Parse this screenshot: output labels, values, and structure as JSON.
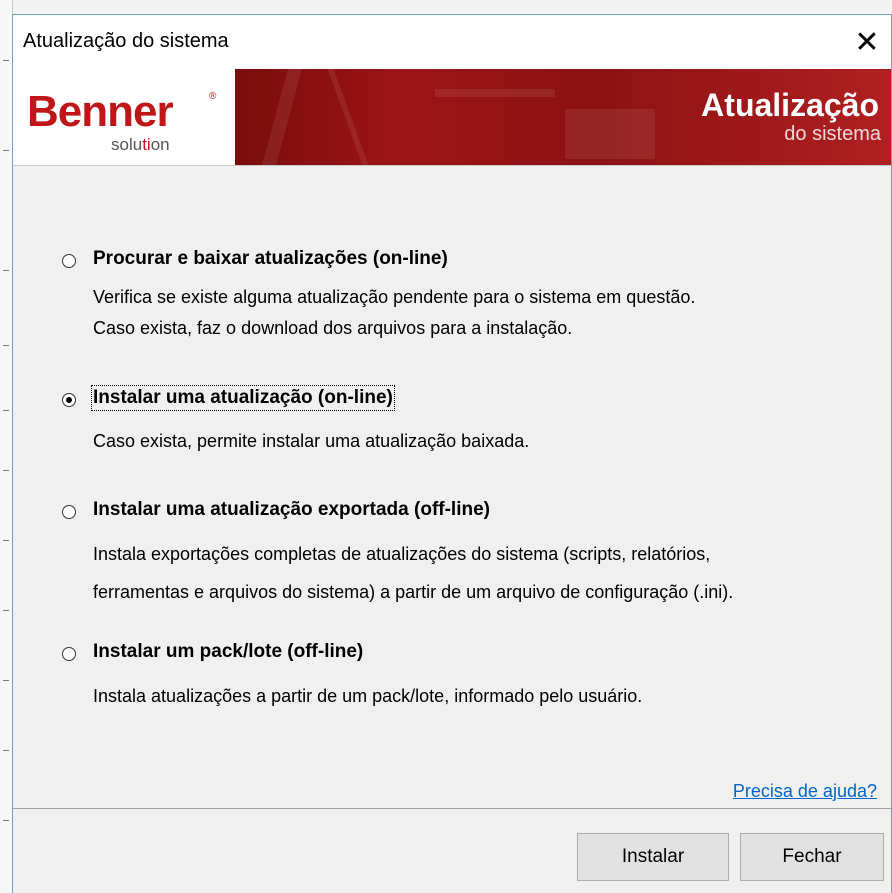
{
  "window": {
    "title": "Atualização do sistema",
    "close_glyph": "✕"
  },
  "banner": {
    "logo_main": "Benner",
    "logo_registered": "®",
    "logo_sub_part1": "solu",
    "logo_sub_accent": "ti",
    "logo_sub_part2": "on",
    "title": "Atualização",
    "subtitle": "do sistema",
    "colors": {
      "brand_red": "#c0161a",
      "banner_dark": "#7a0c0d"
    }
  },
  "options": [
    {
      "label": "Procurar e baixar atualizações (on-line)",
      "selected": false,
      "description": [
        "Verifica se existe alguma atualização pendente para o sistema em questão.",
        "Caso exista, faz o download dos arquivos para a instalação."
      ]
    },
    {
      "label": "Instalar uma atualização (on-line)",
      "selected": true,
      "description": [
        "Caso exista, permite instalar uma atualização baixada."
      ]
    },
    {
      "label": "Instalar uma atualização exportada (off-line)",
      "selected": false,
      "description": [
        "Instala exportações completas de atualizações do sistema (scripts, relatórios,",
        "ferramentas e arquivos do sistema) a partir de um arquivo de configuração (.ini)."
      ]
    },
    {
      "label": "Instalar um pack/lote (off-line)",
      "selected": false,
      "description": [
        "Instala atualizações a partir de um pack/lote, informado pelo usuário."
      ]
    }
  ],
  "help_link": "Precisa de ajuda?",
  "buttons": {
    "install": "Instalar",
    "close": "Fechar"
  }
}
